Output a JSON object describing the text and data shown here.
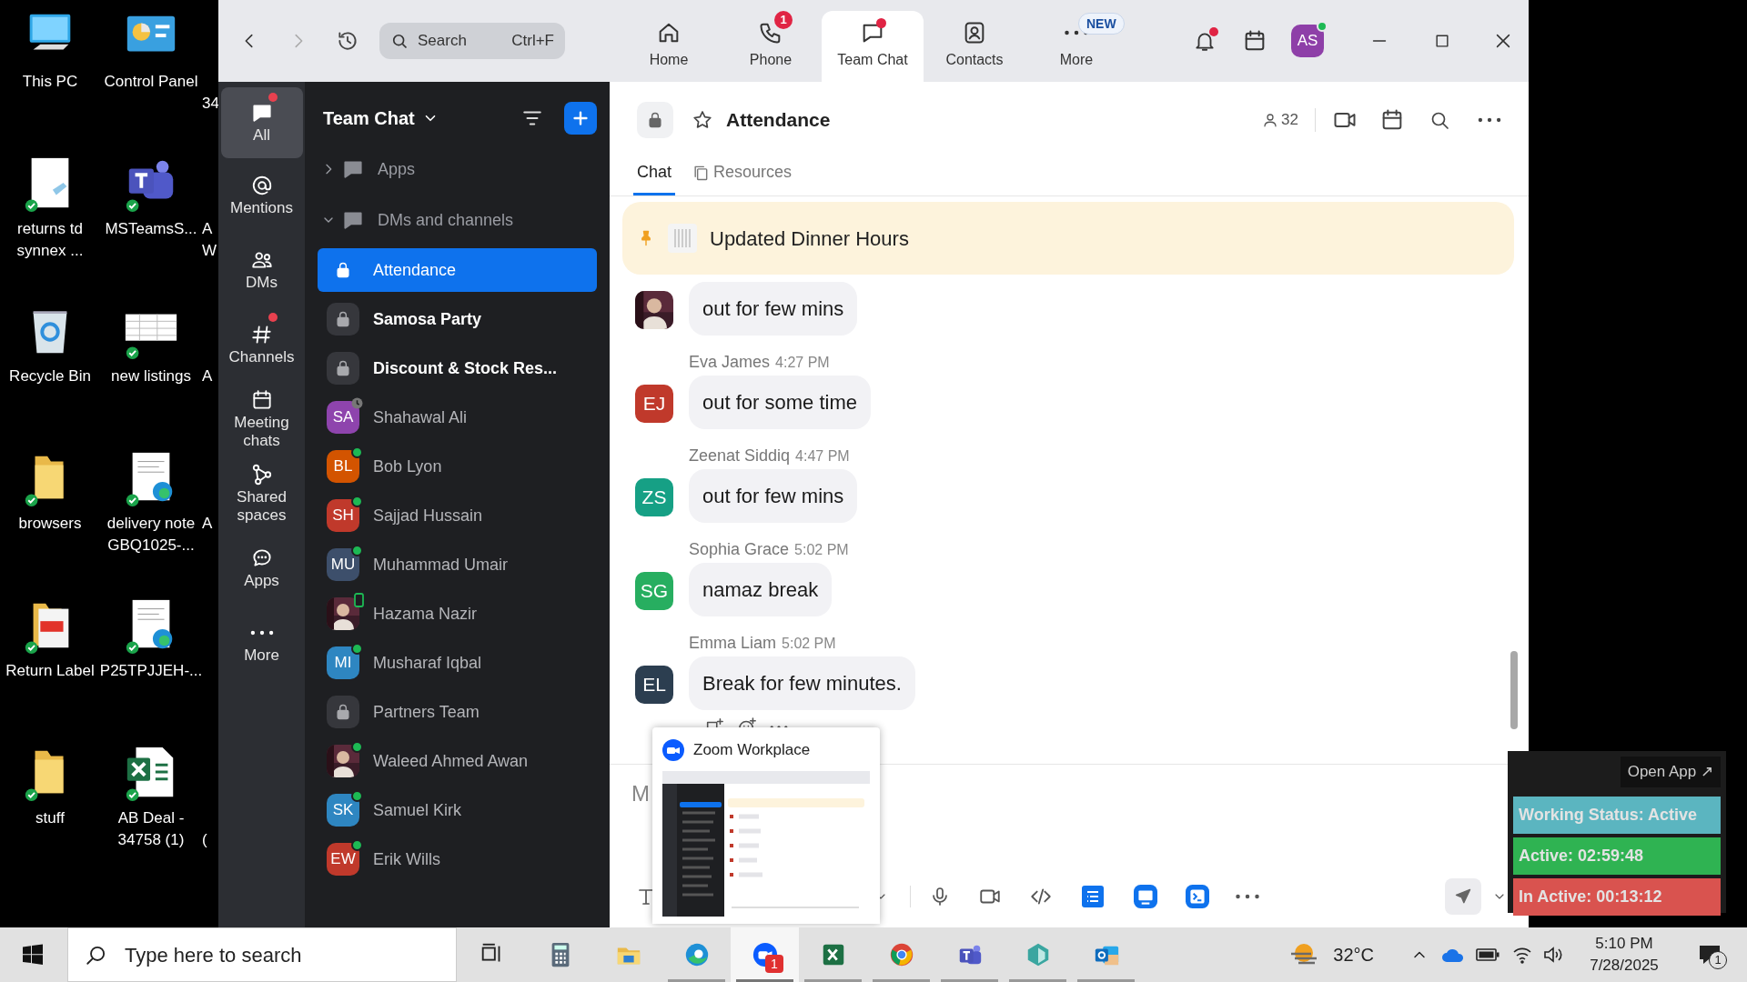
{
  "desktop": {
    "rows": [
      {
        "icons": [
          {
            "kind": "pc",
            "label": "This PC",
            "synced": false
          },
          {
            "kind": "control-panel",
            "label": "Control Panel",
            "synced": false
          }
        ],
        "cut_label": "\n34"
      },
      {
        "icons": [
          {
            "kind": "document",
            "label": "returns td\nsynnex ...",
            "synced": true
          },
          {
            "kind": "teams",
            "label": "MSTeamsS...",
            "synced": true
          }
        ],
        "cut_label": "A\nW"
      },
      {
        "icons": [
          {
            "kind": "recycle",
            "label": "Recycle Bin",
            "synced": false
          },
          {
            "kind": "sheet-thumb",
            "label": "new listings",
            "synced": true
          }
        ],
        "cut_label": "A"
      },
      {
        "icons": [
          {
            "kind": "folder",
            "label": "browsers",
            "synced": true
          },
          {
            "kind": "edge-doc",
            "label": "delivery note\nGBQ1025-...",
            "synced": true
          }
        ],
        "cut_label": "A"
      },
      {
        "icons": [
          {
            "kind": "pdf",
            "label": "Return Label",
            "synced": true
          },
          {
            "kind": "edge-doc",
            "label": "P25TPJJEH-...",
            "synced": true
          }
        ]
      },
      {
        "icons": [
          {
            "kind": "folder",
            "label": "stuff",
            "synced": true
          },
          {
            "kind": "excel",
            "label": "AB Deal -\n34758 (1)",
            "synced": true
          }
        ],
        "cut_label": "\n("
      }
    ]
  },
  "top_bar": {
    "search": {
      "placeholder": "Search",
      "shortcut": "Ctrl+F"
    },
    "tabs": [
      {
        "label": "Home",
        "selected": false,
        "dot": false
      },
      {
        "label": "Phone",
        "selected": false,
        "dot": false,
        "badge": "1"
      },
      {
        "label": "Team Chat",
        "selected": true,
        "dot": true
      },
      {
        "label": "Contacts",
        "selected": false,
        "dot": false
      },
      {
        "label": "More",
        "selected": false,
        "dot": false,
        "badge": "NEW"
      }
    ],
    "notifications_dot": true,
    "user": {
      "initials": "AS",
      "online": true
    }
  },
  "nav_rail": [
    {
      "label": "All",
      "selected": true,
      "dot": true
    },
    {
      "label": "Mentions",
      "selected": false,
      "dot": false
    },
    {
      "label": "DMs",
      "selected": false,
      "dot": false
    },
    {
      "label": "Channels",
      "selected": false,
      "dot": true
    },
    {
      "label": "Meeting\nchats",
      "selected": false,
      "dot": false
    },
    {
      "label": "Shared\nspaces",
      "selected": false,
      "dot": false
    },
    {
      "label": "Apps",
      "selected": false,
      "dot": false
    },
    {
      "label": "More",
      "selected": false,
      "dot": false
    }
  ],
  "sidebar": {
    "title": "Team Chat",
    "sections": [
      {
        "label": "Apps",
        "expanded": false
      },
      {
        "label": "DMs and channels",
        "expanded": true,
        "children": [
          {
            "kind": "channel",
            "name": "Attendance",
            "selected": true,
            "unread": false,
            "online": false,
            "away": false,
            "on_mobile": false
          },
          {
            "kind": "channel",
            "name": "Samosa Party",
            "selected": false,
            "unread": true,
            "online": false,
            "away": false,
            "on_mobile": false
          },
          {
            "kind": "channel",
            "name": "Discount & Stock Res...",
            "selected": false,
            "unread": true,
            "online": false,
            "away": false,
            "on_mobile": false
          },
          {
            "kind": "person",
            "name": "Shahawal Ali",
            "initials": "SA",
            "color": "#8e44ad",
            "selected": false,
            "unread": false,
            "online": false,
            "away": true,
            "on_mobile": false
          },
          {
            "kind": "person",
            "name": "Bob Lyon",
            "initials": "BL",
            "color": "#d35400",
            "selected": false,
            "unread": false,
            "online": true,
            "away": false,
            "on_mobile": false
          },
          {
            "kind": "person",
            "name": "Sajjad Hussain",
            "initials": "SH",
            "color": "#c0392b",
            "selected": false,
            "unread": false,
            "online": true,
            "away": false,
            "on_mobile": false
          },
          {
            "kind": "person",
            "name": "Muhammad Umair",
            "initials": "MU",
            "color": "#3d4f6b",
            "selected": false,
            "unread": false,
            "online": true,
            "away": false,
            "on_mobile": false
          },
          {
            "name": "Hazama Nazir",
            "selected": false,
            "unread": false,
            "online": false,
            "away": false,
            "on_mobile": true
          },
          {
            "kind": "person",
            "name": "Musharaf Iqbal",
            "initials": "MI",
            "color": "#2e86c1",
            "selected": false,
            "unread": false,
            "online": true,
            "away": false,
            "on_mobile": false
          },
          {
            "kind": "channel",
            "name": "Partners Team",
            "selected": false,
            "unread": false,
            "online": false,
            "away": false,
            "on_mobile": false
          },
          {
            "name": "Waleed Ahmed Awan",
            "selected": false,
            "unread": false,
            "online": true,
            "away": false,
            "on_mobile": false
          },
          {
            "kind": "person",
            "name": "Samuel Kirk",
            "initials": "SK",
            "color": "#2e86c1",
            "selected": false,
            "unread": false,
            "online": true,
            "away": false,
            "on_mobile": false
          },
          {
            "kind": "person",
            "name": "Erik Wills",
            "initials": "EW",
            "color": "#c0392b",
            "selected": false,
            "unread": false,
            "online": true,
            "away": false,
            "on_mobile": false
          }
        ]
      }
    ]
  },
  "chat": {
    "title": "Attendance",
    "members": "32",
    "tabs": [
      {
        "label": "Chat",
        "selected": true
      },
      {
        "label": "Resources",
        "selected": false
      }
    ],
    "pinned": "Updated Dinner Hours",
    "messages": [
      {
        "text": "out for few mins"
      },
      {
        "kind": "initials",
        "initials": "EJ",
        "color": "#c0392b",
        "sender": "Eva James",
        "time": "4:27 PM",
        "text": "out for some time"
      },
      {
        "kind": "initials",
        "initials": "ZS",
        "color": "#16a085",
        "sender": "Zeenat Siddiq",
        "time": "4:47 PM",
        "text": "out for few mins"
      },
      {
        "kind": "initials",
        "initials": "SG",
        "color": "#27ae60",
        "sender": "Sophia Grace",
        "time": "5:02 PM",
        "text": "namaz break"
      },
      {
        "kind": "initials",
        "initials": "EL",
        "color": "#2c3e50",
        "sender": "Emma Liam",
        "time": "5:02 PM",
        "text": "Break for few minutes."
      }
    ],
    "composer": {
      "placeholder": "M"
    }
  },
  "preview": {
    "title": "Zoom Workplace"
  },
  "status_widget": {
    "open_app": "Open App ↗",
    "statuses": [
      {
        "text": "Working Status: Active",
        "color": "#5bb5c0"
      },
      {
        "text": "Active: 02:59:48",
        "color": "#2fb352"
      },
      {
        "text": "In Active: 00:13:12",
        "color": "#d9534f"
      }
    ]
  },
  "taskbar": {
    "search": {
      "placeholder": "Type here to search"
    },
    "apps": [
      {
        "kind": "task-view",
        "running": false,
        "active": false
      },
      {
        "kind": "calculator",
        "running": false,
        "active": false
      },
      {
        "kind": "explorer",
        "running": false,
        "active": false
      },
      {
        "kind": "edge",
        "running": true,
        "active": false
      },
      {
        "kind": "zoom",
        "running": true,
        "active": true,
        "badge": "1"
      },
      {
        "kind": "excel",
        "running": true,
        "active": false
      },
      {
        "kind": "chrome",
        "running": true,
        "active": false
      },
      {
        "kind": "teams",
        "running": true,
        "active": false
      },
      {
        "kind": "app",
        "running": true,
        "active": false
      },
      {
        "kind": "outlook",
        "running": true,
        "active": false
      }
    ],
    "weather": "32°C",
    "time": "5:10 PM",
    "date": "7/28/2025",
    "notifications": "1"
  }
}
